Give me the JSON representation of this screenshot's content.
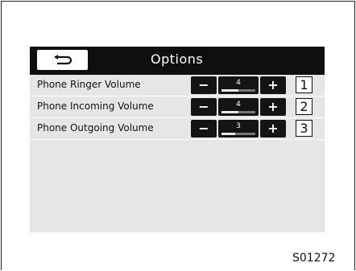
{
  "header": {
    "title": "Options"
  },
  "rows": [
    {
      "label": "Phone Ringer Volume",
      "value": "4",
      "level": 0.5,
      "callout": "1"
    },
    {
      "label": "Phone Incoming Volume",
      "value": "4",
      "level": 0.5,
      "callout": "2"
    },
    {
      "label": "Phone Outgoing Volume",
      "value": "3",
      "level": 0.4,
      "callout": "3"
    }
  ],
  "controls": {
    "minus": "−",
    "plus": "+"
  },
  "figure_ref": "S01272",
  "icons": {
    "back": "return-arrow-icon"
  }
}
